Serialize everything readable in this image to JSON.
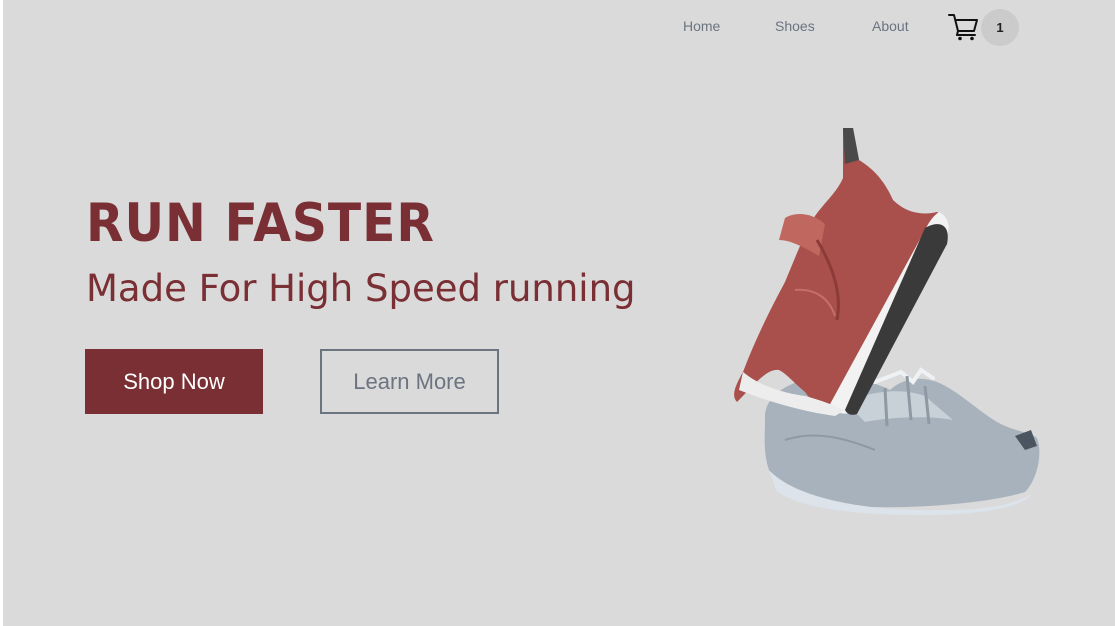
{
  "nav": {
    "links": [
      {
        "label": "Home"
      },
      {
        "label": "Shoes"
      },
      {
        "label": "About"
      }
    ],
    "cart": {
      "icon": "shopping-cart-icon",
      "count": "1"
    }
  },
  "hero": {
    "title": "RUN FASTER",
    "subtitle": "Made For High Speed running",
    "primary_button": "Shop Now",
    "secondary_button": "Learn More"
  },
  "colors": {
    "background": "#dadada",
    "accent": "#7a2f34",
    "muted": "#6c7480",
    "badge": "#cbcbcb"
  }
}
